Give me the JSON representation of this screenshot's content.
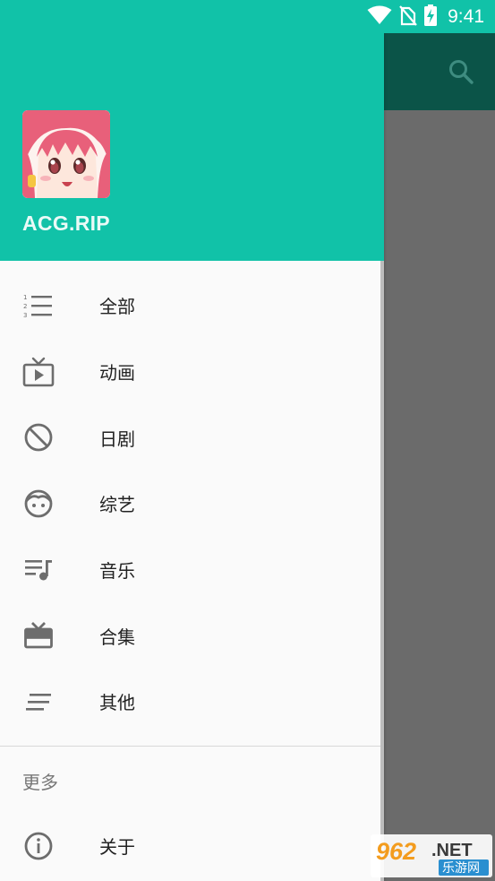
{
  "status_bar": {
    "time": "9:41",
    "icons": [
      "wifi-icon",
      "no-sim-icon",
      "battery-charging-icon"
    ]
  },
  "toolbar": {
    "search_icon": "search-icon",
    "color": "#0b5448"
  },
  "drawer": {
    "header": {
      "title": "ACG.RIP",
      "background": "#11c2a8"
    },
    "items": [
      {
        "label": "全部",
        "icon": "numbered-list-icon"
      },
      {
        "label": "动画",
        "icon": "tv-icon"
      },
      {
        "label": "日剧",
        "icon": "block-icon"
      },
      {
        "label": "综艺",
        "icon": "face-icon"
      },
      {
        "label": "音乐",
        "icon": "music-list-icon"
      },
      {
        "label": "合集",
        "icon": "gift-box-icon"
      },
      {
        "label": "其他",
        "icon": "short-text-icon"
      }
    ],
    "more_section": {
      "header": "更多",
      "items": [
        {
          "label": "关于",
          "icon": "info-icon"
        }
      ]
    }
  },
  "watermark": {
    "number": "962",
    "domain": ".NET",
    "caption": "乐游网"
  }
}
